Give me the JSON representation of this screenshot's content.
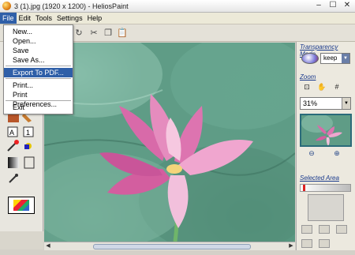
{
  "window": {
    "title": "3 (1).jpg (1920 x 1200) - HeliosPaint",
    "minimize_glyph": "–",
    "maximize_glyph": "☐",
    "close_glyph": "✕"
  },
  "menubar": {
    "items": [
      "File",
      "Edit",
      "Tools",
      "Settings",
      "Help"
    ],
    "active": "File"
  },
  "file_menu": {
    "items": [
      "New...",
      "Open...",
      "Save",
      "Save As...",
      "Export To PDF...",
      "Print...",
      "Print Preferences...",
      "Exit"
    ],
    "highlighted": "Export To PDF...",
    "separator_after": [
      "Save As...",
      "Export To PDF...",
      "Print Preferences..."
    ]
  },
  "right_panel": {
    "transparency_title": "Transparency Mode",
    "transparency_value": "keep",
    "zoom_title": "Zoom",
    "zoom_value": "31%",
    "selected_area_title": "Selected Area"
  },
  "colors": {
    "menu_highlight": "#2f5fa8",
    "section_title": "#1a3a8c",
    "canvas_bg": "#5f9c86",
    "flower_pink": "#e27ab8"
  },
  "icons": {
    "toolbar": [
      "redo-icon",
      "cut-icon",
      "copy-icon",
      "paste-icon"
    ],
    "zoom": [
      "zoom-fit-icon",
      "zoom-hand-icon",
      "zoom-grid-icon"
    ]
  }
}
